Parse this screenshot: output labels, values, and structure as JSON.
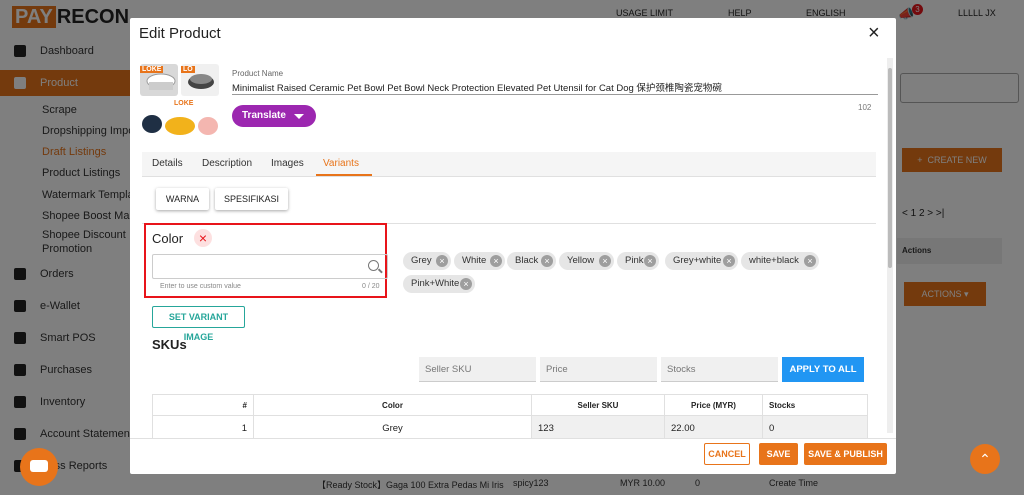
{
  "app": {
    "logo_pay": "PAY",
    "logo_recon": "RECON",
    "header_items": [
      "USAGE LIMIT",
      "HELP",
      "ENGLISH"
    ],
    "notification_count": "3",
    "user_name": "LLLLL JX"
  },
  "sidebar": {
    "items": [
      {
        "label": "Dashboard",
        "icon": "chart-icon"
      },
      {
        "label": "Product",
        "icon": "box-icon",
        "active": true
      },
      {
        "label": "Orders",
        "icon": "clipboard-icon"
      },
      {
        "label": "e-Wallet",
        "icon": "wallet-icon"
      },
      {
        "label": "Smart POS",
        "icon": "pos-icon"
      },
      {
        "label": "Purchases",
        "icon": "truck-icon"
      },
      {
        "label": "Inventory",
        "icon": "boxes-icon"
      },
      {
        "label": "Account Statement Up",
        "icon": "upload-icon"
      },
      {
        "label": "iness Reports",
        "icon": "report-icon"
      }
    ],
    "product_sub": [
      "Scrape",
      "Dropshipping Import",
      "Draft Listings",
      "Product Listings",
      "Watermark Template",
      "Shopee Boost Manag",
      "Shopee Discount",
      "Promotion"
    ]
  },
  "background": {
    "create_new": "CREATE NEW",
    "actions_header": "Actions",
    "actions_button": "ACTIONS",
    "pager": "< 1 2 > >|",
    "bottom_row": [
      "【Ready Stock】Gaga 100 Extra Pedas Mi Iris",
      "spicy123",
      "MYR 10.00",
      "0",
      "Create Time"
    ]
  },
  "modal": {
    "title": "Edit Product",
    "close": "×",
    "product_name_label": "Product Name",
    "product_name": "Minimalist Raised Ceramic Pet Bowl Pet Bowl Neck Protection Elevated Pet Utensil for Cat Dog 保护颈椎陶瓷宠物碗",
    "char_count": "102",
    "translate_label": "Translate",
    "thumb_logo_a": "LOKE",
    "thumb_logo_b": "LO",
    "thumb_logo_c": "LOKE",
    "tabs": [
      "Details",
      "Description",
      "Images",
      "Variants"
    ],
    "active_tab": "Variants",
    "variant_tabs": [
      "WARNA",
      "SPESIFIKASI"
    ],
    "color": {
      "title": "Color",
      "remove": "×",
      "input_value": "",
      "hint": "Enter to use custom value",
      "count": "0 / 20"
    },
    "chips": [
      "Grey",
      "White",
      "Black",
      "Yellow",
      "Pink",
      "Grey+white",
      "white+black",
      "Pink+White"
    ],
    "set_variant_image": "SET VARIANT IMAGE",
    "skus_title": "SKUs",
    "sku_fields": {
      "seller_sku": "Seller SKU",
      "price": "Price",
      "stocks": "Stocks"
    },
    "apply_all": "APPLY TO ALL",
    "table": {
      "headers": [
        "#",
        "Color",
        "Seller SKU",
        "Price (MYR)",
        "Stocks"
      ],
      "rows": [
        {
          "num": "1",
          "color": "Grey",
          "sku": "123",
          "price": "22.00",
          "stocks": "0"
        }
      ]
    },
    "buttons": {
      "cancel": "CANCEL",
      "save": "SAVE",
      "publish": "SAVE & PUBLISH"
    }
  },
  "colors": {
    "accent": "#e8741a",
    "purple": "#9c27b0",
    "blue": "#2196f3",
    "teal": "#26a69a",
    "error": "#e8141a"
  }
}
